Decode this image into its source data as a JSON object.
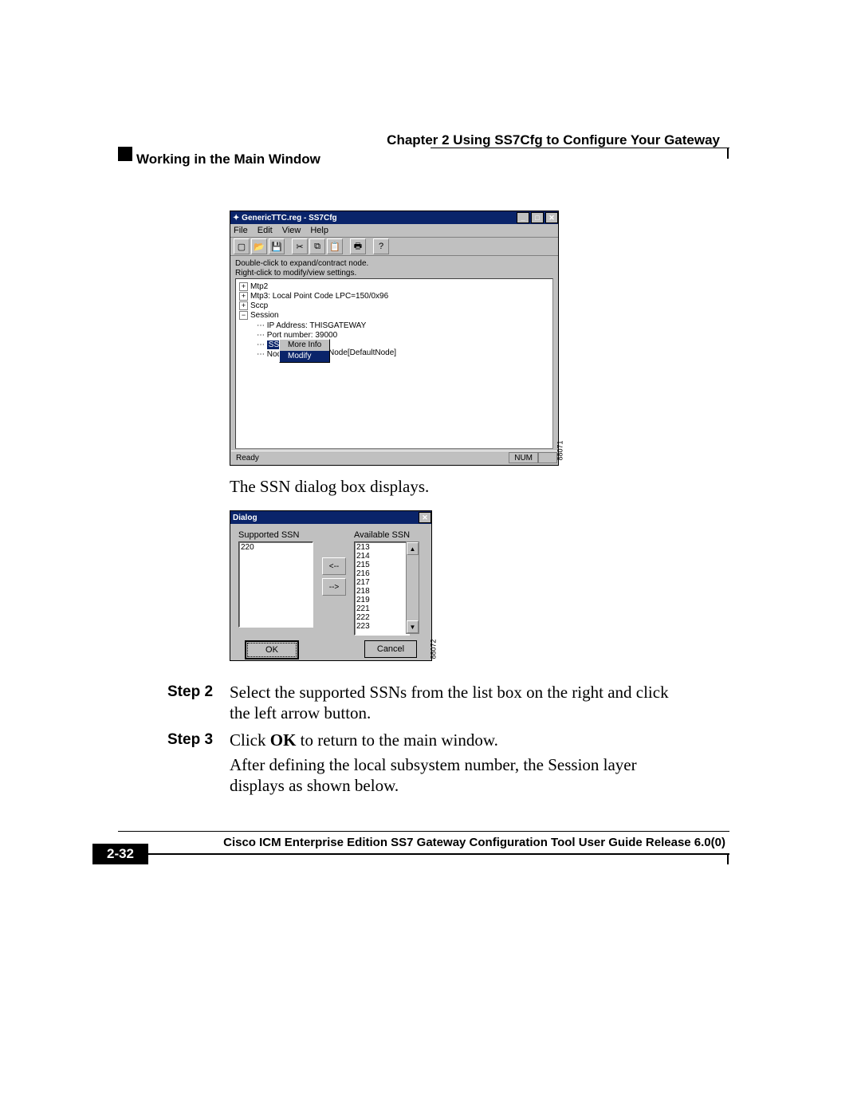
{
  "header": {
    "chapter": "Chapter 2    Using SS7Cfg to Configure Your Gateway",
    "section": "Working in the Main Window"
  },
  "screenshot1": {
    "title": "GenericTTC.reg - SS7Cfg",
    "menus": [
      "File",
      "Edit",
      "View",
      "Help"
    ],
    "toolbar_icons": [
      "new",
      "open",
      "save",
      "cut",
      "copy",
      "paste",
      "print",
      "help"
    ],
    "hint1": "Double-click to expand/contract node.",
    "hint2": "Right-click to modify/view settings.",
    "tree": {
      "mtp2": "Mtp2",
      "mtp3": "Mtp3: Local Point Code LPC=150/0x96",
      "sccp": "Sccp",
      "session": "Session",
      "ip": "IP Address: THISGATEWAY",
      "port": "Port number: 39000",
      "ssn": "SSN:",
      "node": "Node: Cu",
      "node_tail": "Node[DefaultNode]"
    },
    "context": {
      "more_info": "More Info",
      "modify": "Modify"
    },
    "status": {
      "ready": "Ready",
      "num": "NUM"
    },
    "fig_ref": "88071"
  },
  "caption1": "The SSN dialog box displays.",
  "screenshot2": {
    "title": "Dialog",
    "supported_label": "Supported SSN",
    "available_label": "Available SSN",
    "supported": [
      "220"
    ],
    "available": [
      "213",
      "214",
      "215",
      "216",
      "217",
      "218",
      "219",
      "221",
      "222",
      "223"
    ],
    "move_left": "<--",
    "move_right": "-->",
    "ok": "OK",
    "cancel": "Cancel",
    "fig_ref": "88072"
  },
  "steps": {
    "s2_label": "Step 2",
    "s2_text": "Select the supported SSNs from the list box on the right and click the left arrow button.",
    "s3_label": "Step 3",
    "s3_text_a": "Click ",
    "s3_text_ok": "OK",
    "s3_text_b": " to return to the main window.",
    "s3_follow": "After defining the local subsystem number, the Session layer displays as shown below."
  },
  "footer": {
    "title": "Cisco ICM Enterprise Edition SS7 Gateway Configuration Tool User Guide Release 6.0(0)",
    "page": "2-32"
  }
}
